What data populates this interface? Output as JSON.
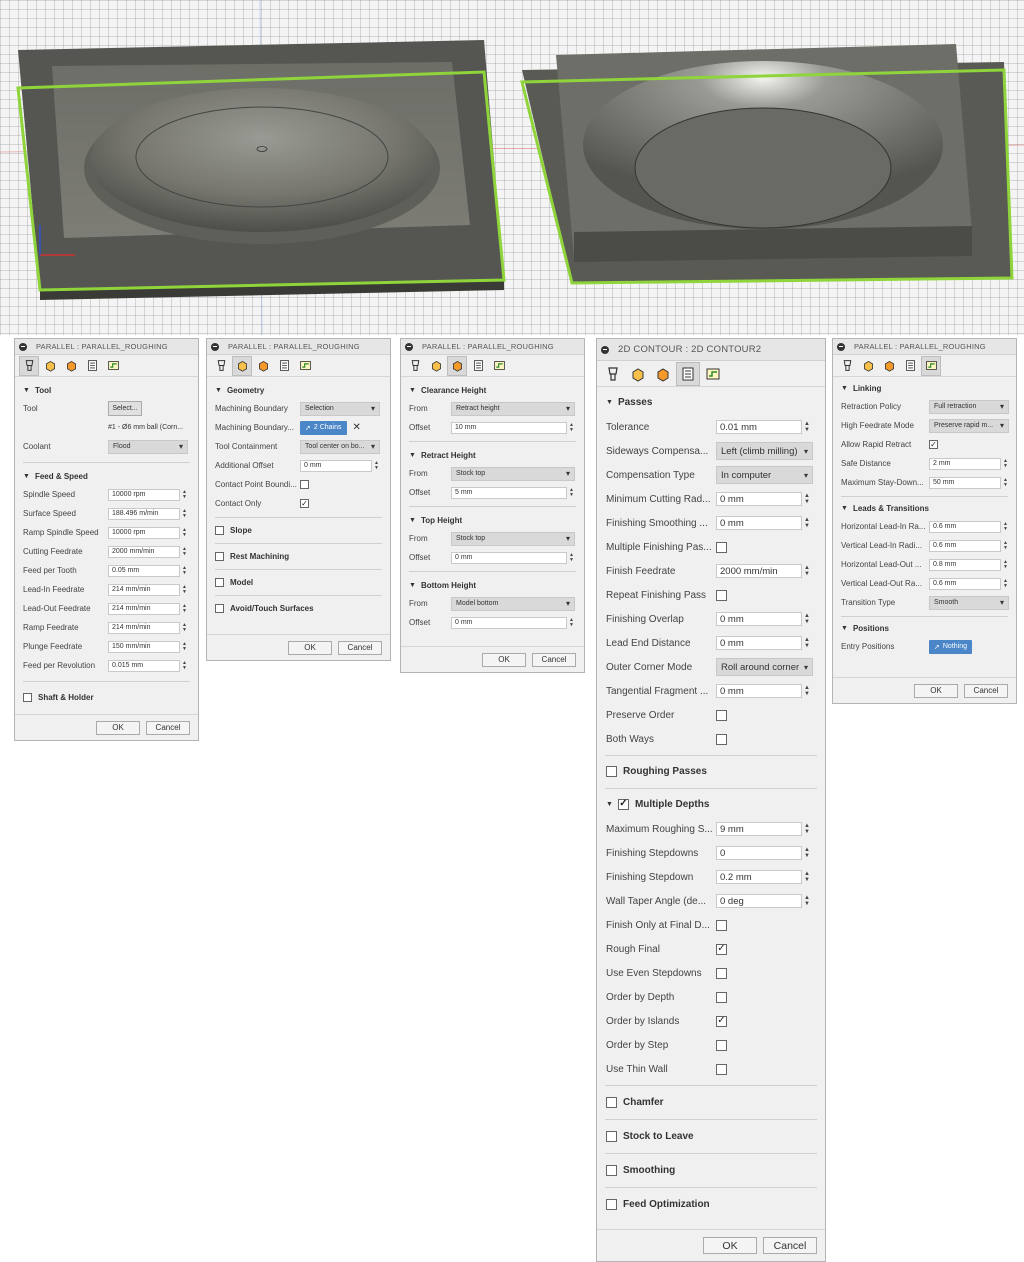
{
  "viewport": {
    "edge_color": "#8fd43a",
    "body_color": "#6a6a66"
  },
  "icons": {
    "tool": "tool-icon",
    "geometry": "geometry-icon",
    "heights": "heights-icon",
    "passes": "passes-icon",
    "linking": "linking-icon",
    "collapse": "collapse-icon",
    "chevron": "chevron-down-icon",
    "pointer": "pointer-icon",
    "clear": "close-icon"
  },
  "buttons": {
    "ok": "OK",
    "cancel": "Cancel"
  },
  "p1": {
    "title": "PARALLEL : PARALLEL_ROUGHING",
    "tool_section": "Tool",
    "tool_label": "Tool",
    "tool_select": "Select...",
    "tool_name": "#1 - Ø6 mm ball (Corn...",
    "coolant_label": "Coolant",
    "coolant_value": "Flood",
    "feed_section": "Feed & Speed",
    "rows": [
      {
        "label": "Spindle Speed",
        "value": "10000 rpm"
      },
      {
        "label": "Surface Speed",
        "value": "188.496 m/min"
      },
      {
        "label": "Ramp Spindle Speed",
        "value": "10000 rpm"
      },
      {
        "label": "Cutting Feedrate",
        "value": "2000 mm/min"
      },
      {
        "label": "Feed per Tooth",
        "value": "0.05 mm"
      },
      {
        "label": "Lead-In Feedrate",
        "value": "214 mm/min"
      },
      {
        "label": "Lead-Out Feedrate",
        "value": "214 mm/min"
      },
      {
        "label": "Ramp Feedrate",
        "value": "214 mm/min"
      },
      {
        "label": "Plunge Feedrate",
        "value": "150 mm/min"
      },
      {
        "label": "Feed per Revolution",
        "value": "0.015 mm"
      }
    ],
    "shaft_section": "Shaft & Holder"
  },
  "p2": {
    "title": "PARALLEL : PARALLEL_ROUGHING",
    "geometry_section": "Geometry",
    "machining_boundary_label": "Machining Boundary",
    "machining_boundary_value": "Selection",
    "boundary_sel_label": "Machining Boundary...",
    "boundary_sel_value": "2 Chains",
    "containment_label": "Tool Containment",
    "containment_value": "Tool center on bo...",
    "offset_label": "Additional Offset",
    "offset_value": "0 mm",
    "contact_point_label": "Contact Point Boundi...",
    "contact_only_label": "Contact Only",
    "slope": "Slope",
    "rest": "Rest Machining",
    "model": "Model",
    "avoid": "Avoid/Touch Surfaces"
  },
  "p3": {
    "title": "PARALLEL : PARALLEL_ROUGHING",
    "groups": [
      {
        "name": "Clearance Height",
        "from": "Retract height",
        "offset": "10 mm"
      },
      {
        "name": "Retract Height",
        "from": "Stock top",
        "offset": "5 mm"
      },
      {
        "name": "Top Height",
        "from": "Stock top",
        "offset": "0 mm"
      },
      {
        "name": "Bottom Height",
        "from": "Model bottom",
        "offset": "0 mm"
      }
    ],
    "from_label": "From",
    "offset_label": "Offset"
  },
  "p4": {
    "title": "2D CONTOUR : 2D CONTOUR2",
    "passes_section": "Passes",
    "tolerance_label": "Tolerance",
    "tolerance": "0.01 mm",
    "sideways_label": "Sideways Compensa...",
    "sideways": "Left (climb milling)",
    "comp_type_label": "Compensation Type",
    "comp_type": "In computer",
    "min_rad_label": "Minimum Cutting Rad...",
    "min_rad": "0 mm",
    "smoothing_label": "Finishing Smoothing ...",
    "smoothing": "0 mm",
    "multi_fin_label": "Multiple Finishing Pas...",
    "finish_feed_label": "Finish Feedrate",
    "finish_feed": "2000 mm/min",
    "repeat_label": "Repeat Finishing Pass",
    "overlap_label": "Finishing Overlap",
    "overlap": "0 mm",
    "lead_end_label": "Lead End Distance",
    "lead_end": "0 mm",
    "outer_label": "Outer Corner Mode",
    "outer": "Roll around corner",
    "tang_label": "Tangential Fragment ...",
    "tang": "0 mm",
    "preserve_label": "Preserve Order",
    "both_label": "Both Ways",
    "roughing_section": "Roughing Passes",
    "depths_section": "Multiple Depths",
    "max_step_label": "Maximum Roughing S...",
    "max_step": "9 mm",
    "fin_steps_label": "Finishing Stepdowns",
    "fin_steps": "0",
    "fin_step_label": "Finishing Stepdown",
    "fin_step": "0.2 mm",
    "taper_label": "Wall Taper Angle (de...",
    "taper": "0 deg",
    "final_only_label": "Finish Only at Final D...",
    "rough_final_label": "Rough Final",
    "even_label": "Use Even Stepdowns",
    "order_depth_label": "Order by Depth",
    "order_islands_label": "Order by Islands",
    "order_step_label": "Order by Step",
    "thin_wall_label": "Use Thin Wall",
    "chamfer": "Chamfer",
    "stock": "Stock to Leave",
    "smoothing_section": "Smoothing",
    "feedopt": "Feed Optimization"
  },
  "p5": {
    "title": "PARALLEL : PARALLEL_ROUGHING",
    "linking_section": "Linking",
    "retraction_label": "Retraction Policy",
    "retraction": "Full retraction",
    "hf_label": "High Feedrate Mode",
    "hf": "Preserve rapid m...",
    "rapid_label": "Allow Rapid Retract",
    "safe_label": "Safe Distance",
    "safe": "2 mm",
    "stay_label": "Maximum Stay-Down...",
    "stay": "50 mm",
    "leads_section": "Leads & Transitions",
    "hli_label": "Horizontal Lead-In Ra...",
    "hli": "0.6 mm",
    "vli_label": "Vertical Lead-In Radi...",
    "vli": "0.6 mm",
    "hlo_label": "Horizontal Lead-Out ...",
    "hlo": "0.8 mm",
    "vlo_label": "Vertical Lead-Out Ra...",
    "vlo": "0.6 mm",
    "trans_label": "Transition Type",
    "trans": "Smooth",
    "positions_section": "Positions",
    "entry_label": "Entry Positions",
    "entry": "Nothing"
  }
}
